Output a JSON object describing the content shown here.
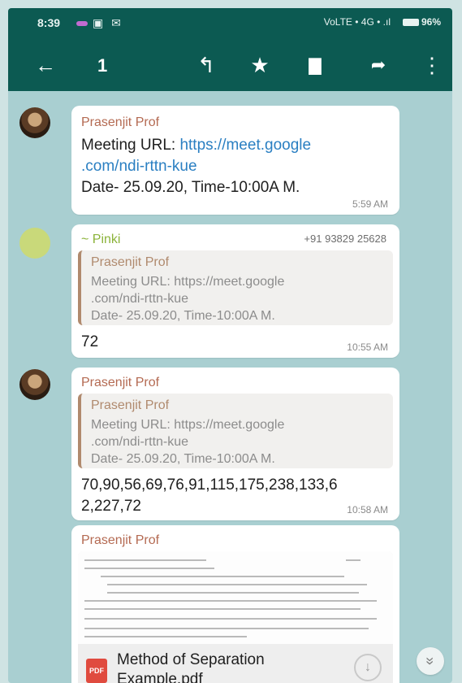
{
  "status": {
    "time": "8:39",
    "battery": "96%",
    "network": "Vo​LTE • 4G • .ıl",
    "icons": "▣ ✉"
  },
  "toolbar": {
    "back_icon": "←",
    "selected_count": "1",
    "reply_icon": "↰",
    "star_icon": "★",
    "delete_icon": "▇",
    "forward_icon": "➦",
    "menu_icon": "⋮"
  },
  "messages": [
    {
      "sender": "Prasenjit Prof",
      "line1": "Meeting URL: ",
      "link1": "https://meet.google",
      "link2": ".com/ndi-rttn-kue",
      "line3": "Date- 25.09.20, Time-10:00A M.",
      "time": "5:59 AM"
    },
    {
      "sender": "~ Pinki",
      "phone": "+91 93829 25628",
      "quote_name": "Prasenjit Prof",
      "quote_l1": "Meeting URL: https://meet.google",
      "quote_l2": ".com/ndi-rttn-kue",
      "quote_l3": "Date- 25.09.20, Time-10:00A M.",
      "text": "72",
      "time": "10:55 AM"
    },
    {
      "sender": "Prasenjit Prof",
      "quote_name": "Prasenjit Prof",
      "quote_l1": "Meeting URL: https://meet.google",
      "quote_l2": ".com/ndi-rttn-kue",
      "quote_l3": "Date- 25.09.20, Time-10:00A M.",
      "text_l1": "70,90,56,69,76,91,115,175,238,133,6",
      "text_l2": "2,227,72",
      "time": "10:58 AM"
    },
    {
      "sender": "Prasenjit Prof",
      "doc_icon": "PDF",
      "doc_name_l1": "Method of Separation",
      "doc_name_l2": "Example.pdf",
      "download_icon": "↓"
    }
  ],
  "scroll_down_icon": "»"
}
